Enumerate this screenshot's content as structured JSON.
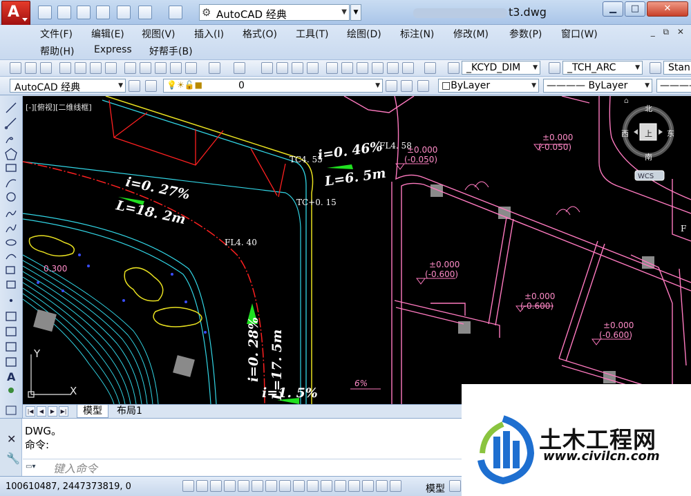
{
  "window": {
    "workspace": "AutoCAD 经典",
    "doc_title_visible": "t3.dwg",
    "app_logo": "A",
    "win_buttons": {
      "minimize": "▁",
      "maximize": "□",
      "close": "✕"
    }
  },
  "menu": {
    "items": [
      "文件(F)",
      "编辑(E)",
      "视图(V)",
      "插入(I)",
      "格式(O)",
      "工具(T)",
      "绘图(D)",
      "标注(N)",
      "修改(M)",
      "参数(P)",
      "窗口(W)",
      "帮助(H)",
      "Express",
      "好帮手(B)"
    ],
    "mdi_controls": "_ ⧉ ✕"
  },
  "toolbar1": {
    "dimstyle": "_KCYD_DIM",
    "textstyle": "_TCH_ARC",
    "tablestyle": "Stan"
  },
  "toolbar2": {
    "workspace": "AutoCAD 经典",
    "layer": "0",
    "color": "ByLayer",
    "linetype": "ByLayer"
  },
  "canvas": {
    "viewport_label": "[-][俯视][二维线框]",
    "viewcube": {
      "north": "北",
      "south": "南",
      "east": "东",
      "west": "西",
      "top_face": "上",
      "wcs": "WCS"
    },
    "labels": {
      "slope1": "i=0. 27%",
      "len1": "L=18. 2m",
      "slope2": "i=0. 46%",
      "len2": "L=6. 5m",
      "slope3": "i=0. 28%",
      "len3": "L=17. 5m",
      "slope4": "i=1. 5%",
      "tc1": "TC4. 55",
      "tc2": "TC+0. 15",
      "fl1": "FL4. 40",
      "fl2": "FL4. 58",
      "elev_a1": "±0.000",
      "elev_a2": "(-0.050)",
      "elev_b1": "±0.000",
      "elev_b2": "(-0.050)",
      "elev_c1": "±0.000",
      "elev_c2": "(-0.600)",
      "elev_d1": "±0.000",
      "elev_d2": "(-0.600)",
      "elev_e1": "±0.000",
      "elev_e2": "(-0.600)",
      "pct6": "6%",
      "edge300": "0.300",
      "edgeF": "F",
      "axis_y": "Y",
      "axis_x": "X"
    }
  },
  "tabs": {
    "model": "模型",
    "layout1": "布局1"
  },
  "command": {
    "history": [
      "DWG。",
      "命令:"
    ],
    "input_placeholder": "键入命令"
  },
  "statusbar": {
    "coords": "100610487, 2447373819, 0",
    "model": "模型"
  },
  "watermark": {
    "title": "土木工程网",
    "url": "www.civilcn.com"
  },
  "colors": {
    "canvas_bg": "#000000",
    "pink": "#ff7ac0",
    "cyan": "#32d6e6",
    "red": "#ff2020",
    "yellow": "#e8e020",
    "green": "#20e020"
  }
}
